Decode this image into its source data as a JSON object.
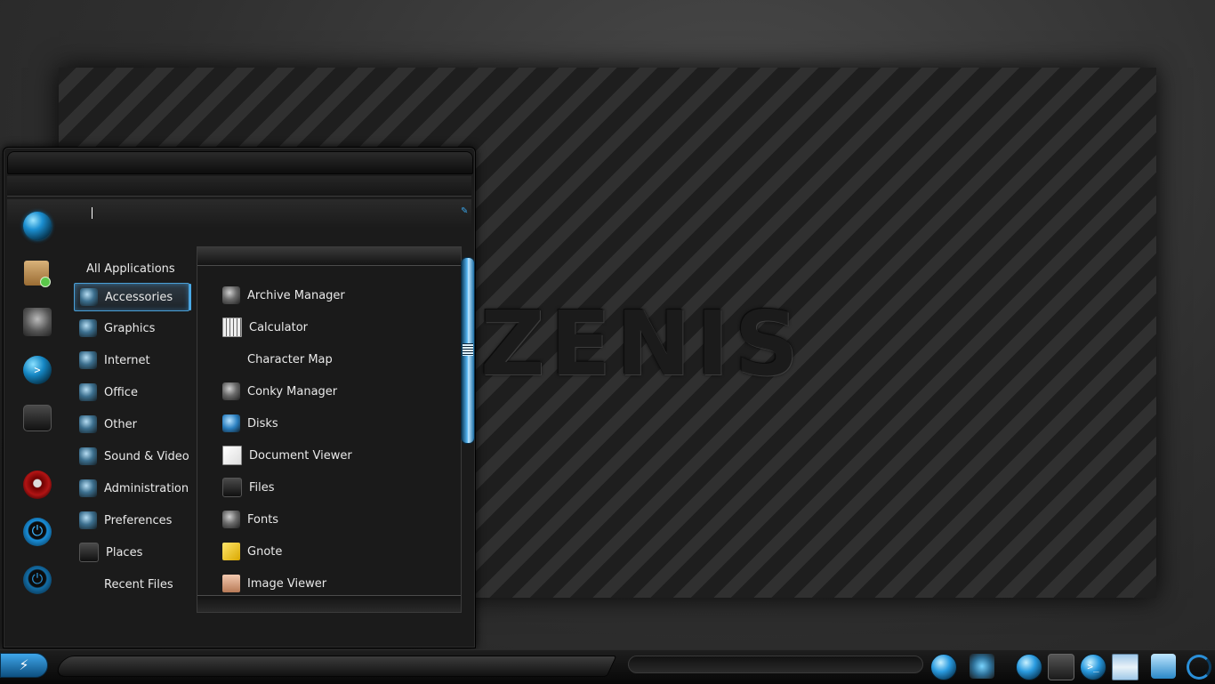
{
  "wallpaper": {
    "logo_text": "ZENIS"
  },
  "menu": {
    "search": {
      "value": "",
      "placeholder": ""
    },
    "favorites": [
      {
        "icon": "orb-logo-icon"
      },
      {
        "icon": "package-icon"
      },
      {
        "icon": "robot-icon"
      },
      {
        "icon": "terminal-icon"
      },
      {
        "icon": "files-icon"
      },
      {
        "icon": "lock-screen-icon"
      },
      {
        "icon": "logout-icon"
      },
      {
        "icon": "power-icon"
      }
    ],
    "categories": [
      {
        "label": "All Applications"
      },
      {
        "label": "Accessories",
        "selected": true
      },
      {
        "label": "Graphics"
      },
      {
        "label": "Internet"
      },
      {
        "label": "Office"
      },
      {
        "label": "Other"
      },
      {
        "label": "Sound & Video"
      },
      {
        "label": "Administration"
      },
      {
        "label": "Preferences"
      },
      {
        "label": "Places"
      },
      {
        "label": "Recent Files"
      }
    ],
    "apps": [
      {
        "label": "Archive Manager"
      },
      {
        "label": "Calculator"
      },
      {
        "label": "Character Map"
      },
      {
        "label": "Conky Manager"
      },
      {
        "label": "Disks"
      },
      {
        "label": "Document Viewer"
      },
      {
        "label": "Files"
      },
      {
        "label": "Fonts"
      },
      {
        "label": "Gnote"
      },
      {
        "label": "Image Viewer"
      }
    ]
  },
  "taskbar": {
    "tray": [
      {
        "icon": "globe-icon"
      },
      {
        "icon": "star-icon"
      },
      {
        "icon": "logo-icon"
      },
      {
        "icon": "files-icon"
      },
      {
        "icon": "terminal-icon",
        "text": ">_"
      },
      {
        "icon": "document-icon"
      },
      {
        "icon": "jar-icon"
      },
      {
        "icon": "refresh-icon"
      }
    ]
  },
  "colors": {
    "accent": "#2a9be0",
    "background": "#1b1b1b"
  }
}
